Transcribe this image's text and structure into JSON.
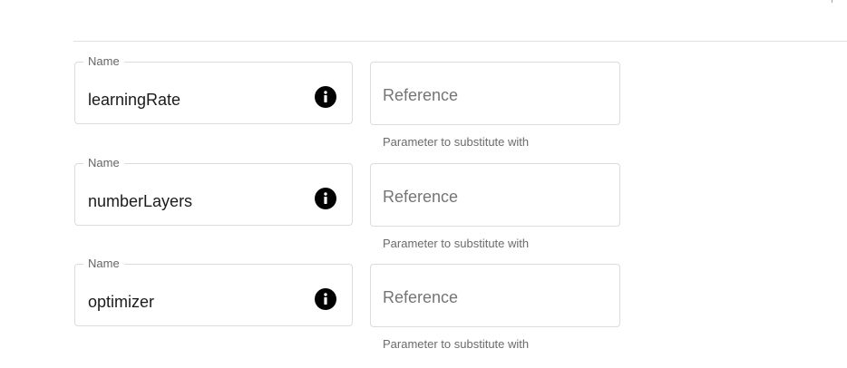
{
  "parameters": [
    {
      "name_label": "Name",
      "name_value": "learningRate",
      "info_icon": "info-icon",
      "reference_placeholder": "Reference",
      "reference_value": "",
      "helper_text": "Parameter to substitute with"
    },
    {
      "name_label": "Name",
      "name_value": "numberLayers",
      "info_icon": "info-icon",
      "reference_placeholder": "Reference",
      "reference_value": "",
      "helper_text": "Parameter to substitute with"
    },
    {
      "name_label": "Name",
      "name_value": "optimizer",
      "info_icon": "info-icon",
      "reference_placeholder": "Reference",
      "reference_value": "",
      "helper_text": "Parameter to substitute with"
    }
  ],
  "colors": {
    "border": "#dcdcdc",
    "text": "#1b1b1b",
    "label": "#666666",
    "icon": "#000000"
  }
}
